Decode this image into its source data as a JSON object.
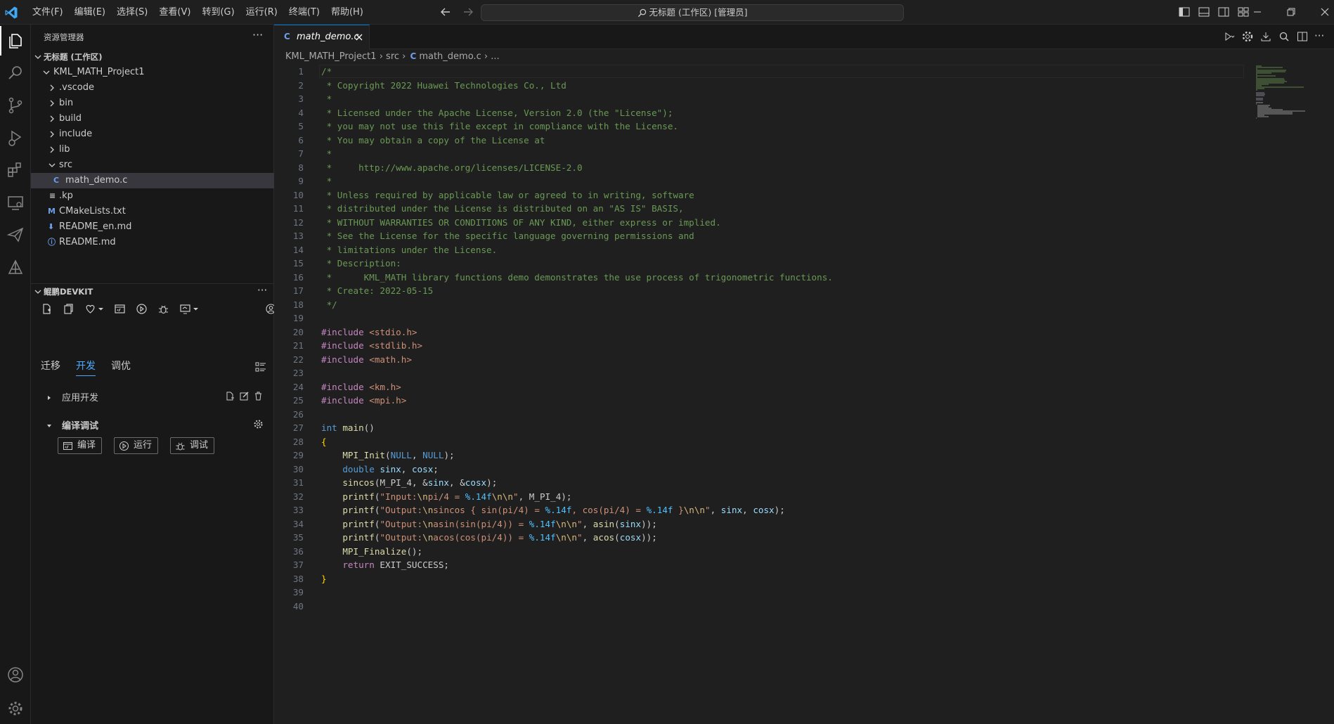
{
  "titlebar": {
    "menu": [
      "文件(F)",
      "编辑(E)",
      "选择(S)",
      "查看(V)",
      "转到(G)",
      "运行(R)",
      "终端(T)",
      "帮助(H)"
    ],
    "command_center": "无标题 (工作区) [管理员]"
  },
  "sidebar": {
    "title": "资源管理器",
    "workspace": "无标题 (工作区)",
    "project": "KML_MATH_Project1",
    "items": [
      ".vscode",
      "bin",
      "build",
      "include",
      "lib",
      "src",
      "math_demo.c",
      ".kp",
      "CMakeLists.txt",
      "README_en.md",
      "README.md"
    ],
    "file_icons": {
      "c": "C",
      "kp": "≡",
      "cmake": "M",
      "readme_en": "⬇",
      "readme": "ⓘ"
    }
  },
  "devkit": {
    "title": "鲲鹏DEVKIT",
    "tabs": [
      "迁移",
      "开发",
      "调优"
    ],
    "active_tab": "开发",
    "sections": [
      "应用开发",
      "编译调试"
    ],
    "buttons": [
      "编译",
      "运行",
      "调试"
    ]
  },
  "editor": {
    "tab_label": "math_demo.c",
    "tab_icon": "C",
    "breadcrumb": [
      "KML_MATH_Project1",
      "src",
      "math_demo.c",
      "..."
    ]
  },
  "code_lines": [
    [
      [
        "c-com",
        "/*"
      ]
    ],
    [
      [
        "c-com",
        " * Copyright 2022 Huawei Technologies Co., Ltd"
      ]
    ],
    [
      [
        "c-com",
        " *"
      ]
    ],
    [
      [
        "c-com",
        " * Licensed under the Apache License, Version 2.0 (the \"License\");"
      ]
    ],
    [
      [
        "c-com",
        " * you may not use this file except in compliance with the License."
      ]
    ],
    [
      [
        "c-com",
        " * You may obtain a copy of the License at"
      ]
    ],
    [
      [
        "c-com",
        " *"
      ]
    ],
    [
      [
        "c-com",
        " *     http://www.apache.org/licenses/LICENSE-2.0"
      ]
    ],
    [
      [
        "c-com",
        " *"
      ]
    ],
    [
      [
        "c-com",
        " * Unless required by applicable law or agreed to in writing, software"
      ]
    ],
    [
      [
        "c-com",
        " * distributed under the License is distributed on an \"AS IS\" BASIS,"
      ]
    ],
    [
      [
        "c-com",
        " * WITHOUT WARRANTIES OR CONDITIONS OF ANY KIND, either express or implied."
      ]
    ],
    [
      [
        "c-com",
        " * See the License for the specific language governing permissions and"
      ]
    ],
    [
      [
        "c-com",
        " * limitations under the License."
      ]
    ],
    [
      [
        "c-com",
        " * Description:"
      ]
    ],
    [
      [
        "c-com",
        " *      KML_MATH library functions demo demonstrates the use process of trigonometric functions."
      ]
    ],
    [
      [
        "c-com",
        " * Create: 2022-05-15"
      ]
    ],
    [
      [
        "c-com",
        " */"
      ]
    ],
    [],
    [
      [
        "c-inc",
        "#include"
      ],
      [
        "c-pl",
        " "
      ],
      [
        "c-str",
        "<stdio.h>"
      ]
    ],
    [
      [
        "c-inc",
        "#include"
      ],
      [
        "c-pl",
        " "
      ],
      [
        "c-str",
        "<stdlib.h>"
      ]
    ],
    [
      [
        "c-inc",
        "#include"
      ],
      [
        "c-pl",
        " "
      ],
      [
        "c-str",
        "<math.h>"
      ]
    ],
    [],
    [
      [
        "c-inc",
        "#include"
      ],
      [
        "c-pl",
        " "
      ],
      [
        "c-str",
        "<km.h>"
      ]
    ],
    [
      [
        "c-inc",
        "#include"
      ],
      [
        "c-pl",
        " "
      ],
      [
        "c-str",
        "<mpi.h>"
      ]
    ],
    [],
    [
      [
        "c-kw",
        "int"
      ],
      [
        "c-pl",
        " "
      ],
      [
        "c-fn",
        "main"
      ],
      [
        "c-pl",
        "()"
      ]
    ],
    [
      [
        "c-br",
        "{"
      ]
    ],
    [
      [
        "c-pl",
        "    "
      ],
      [
        "c-fn",
        "MPI_Init"
      ],
      [
        "c-pl",
        "("
      ],
      [
        "c-kw",
        "NULL"
      ],
      [
        "c-pl",
        ", "
      ],
      [
        "c-kw",
        "NULL"
      ],
      [
        "c-pl",
        ");"
      ]
    ],
    [
      [
        "c-pl",
        "    "
      ],
      [
        "c-kw",
        "double"
      ],
      [
        "c-pl",
        " "
      ],
      [
        "c-var",
        "sinx"
      ],
      [
        "c-pl",
        ", "
      ],
      [
        "c-var",
        "cosx"
      ],
      [
        "c-pl",
        ";"
      ]
    ],
    [
      [
        "c-pl",
        "    "
      ],
      [
        "c-fn",
        "sincos"
      ],
      [
        "c-pl",
        "("
      ],
      [
        "c-pl",
        "M_PI_4"
      ],
      [
        "c-pl",
        ", &"
      ],
      [
        "c-var",
        "sinx"
      ],
      [
        "c-pl",
        ", &"
      ],
      [
        "c-var",
        "cosx"
      ],
      [
        "c-pl",
        ");"
      ]
    ],
    [
      [
        "c-pl",
        "    "
      ],
      [
        "c-fn",
        "printf"
      ],
      [
        "c-pl",
        "("
      ],
      [
        "c-str",
        "\"Input:"
      ],
      [
        "c-esc",
        "\\n"
      ],
      [
        "c-str",
        "pi/4 = "
      ],
      [
        "c-mac",
        "%.14f"
      ],
      [
        "c-esc",
        "\\n\\n"
      ],
      [
        "c-str",
        "\""
      ],
      [
        "c-pl",
        ", M_PI_4);"
      ]
    ],
    [
      [
        "c-pl",
        "    "
      ],
      [
        "c-fn",
        "printf"
      ],
      [
        "c-pl",
        "("
      ],
      [
        "c-str",
        "\"Output:"
      ],
      [
        "c-esc",
        "\\n"
      ],
      [
        "c-str",
        "sincos { sin(pi/4) = "
      ],
      [
        "c-mac",
        "%.14f"
      ],
      [
        "c-str",
        ", cos(pi/4) = "
      ],
      [
        "c-mac",
        "%.14f"
      ],
      [
        "c-str",
        " }"
      ],
      [
        "c-esc",
        "\\n\\n"
      ],
      [
        "c-str",
        "\""
      ],
      [
        "c-pl",
        ", "
      ],
      [
        "c-var",
        "sinx"
      ],
      [
        "c-pl",
        ", "
      ],
      [
        "c-var",
        "cosx"
      ],
      [
        "c-pl",
        ");"
      ]
    ],
    [
      [
        "c-pl",
        "    "
      ],
      [
        "c-fn",
        "printf"
      ],
      [
        "c-pl",
        "("
      ],
      [
        "c-str",
        "\"Output:"
      ],
      [
        "c-esc",
        "\\n"
      ],
      [
        "c-str",
        "asin(sin(pi/4)) = "
      ],
      [
        "c-mac",
        "%.14f"
      ],
      [
        "c-esc",
        "\\n\\n"
      ],
      [
        "c-str",
        "\""
      ],
      [
        "c-pl",
        ", "
      ],
      [
        "c-fn",
        "asin"
      ],
      [
        "c-pl",
        "("
      ],
      [
        "c-var",
        "sinx"
      ],
      [
        "c-pl",
        "));"
      ]
    ],
    [
      [
        "c-pl",
        "    "
      ],
      [
        "c-fn",
        "printf"
      ],
      [
        "c-pl",
        "("
      ],
      [
        "c-str",
        "\"Output:"
      ],
      [
        "c-esc",
        "\\n"
      ],
      [
        "c-str",
        "acos(cos(pi/4)) = "
      ],
      [
        "c-mac",
        "%.14f"
      ],
      [
        "c-esc",
        "\\n\\n"
      ],
      [
        "c-str",
        "\""
      ],
      [
        "c-pl",
        ", "
      ],
      [
        "c-fn",
        "acos"
      ],
      [
        "c-pl",
        "("
      ],
      [
        "c-var",
        "cosx"
      ],
      [
        "c-pl",
        "));"
      ]
    ],
    [
      [
        "c-pl",
        "    "
      ],
      [
        "c-fn",
        "MPI_Finalize"
      ],
      [
        "c-pl",
        "();"
      ]
    ],
    [
      [
        "c-pl",
        "    "
      ],
      [
        "c-inc",
        "return"
      ],
      [
        "c-pl",
        " EXIT_SUCCESS;"
      ]
    ],
    [
      [
        "c-br",
        "}"
      ]
    ],
    [],
    []
  ],
  "colors": {
    "accent": "#0078d4",
    "tab_active_blue": "#4daafc",
    "background": "#1f1f1f"
  }
}
